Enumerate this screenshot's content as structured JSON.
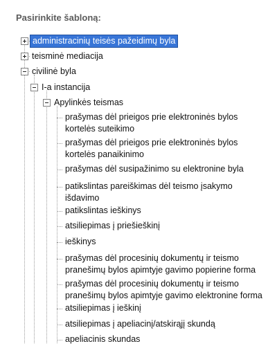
{
  "heading": "Pasirinkite šabloną:",
  "tree": {
    "roots": [
      {
        "label": "administracinių teisės pažeidimų byla",
        "expanded": false,
        "selected": true
      },
      {
        "label": "teisminė mediacija",
        "expanded": false,
        "selected": false
      },
      {
        "label": "civilinė byla",
        "expanded": true,
        "children": [
          {
            "label": "I-a instancija",
            "expanded": true,
            "children": [
              {
                "label": "Apylinkės teismas",
                "expanded": true,
                "documents": [
                  {
                    "line1": "prašymas dėl prieigos prie elektroninės bylos",
                    "line2": "kortelės suteikimo"
                  },
                  {
                    "line1": "prašymas dėl prieigos prie elektroninės bylos",
                    "line2": "kortelės panaikinimo"
                  },
                  {
                    "line1": "prašymas dėl susipažinimo su elektronine byla"
                  },
                  {
                    "line1": "patikslintas pareiškimas dėl teismo įsakymo",
                    "line2": "išdavimo"
                  },
                  {
                    "line1": "patikslintas ieškinys"
                  },
                  {
                    "line1": "atsiliepimas į priešieškinį"
                  },
                  {
                    "line1": "ieškinys"
                  },
                  {
                    "line1": "prašymas dėl procesinių dokumentų ir teismo",
                    "line2": "pranešimų bylos apimtyje gavimo popierine forma"
                  },
                  {
                    "line1": "prašymas dėl procesinių dokumentų ir teismo",
                    "line2": "pranešimų bylos apimtyje gavimo elektronine forma"
                  },
                  {
                    "line1": "atsiliepimas į ieškinį"
                  },
                  {
                    "line1": "atsiliepimas į apeliacinį/atskirąjį skundą"
                  },
                  {
                    "line1": "apeliacinis skundas"
                  }
                ]
              }
            ]
          }
        ]
      }
    ]
  }
}
